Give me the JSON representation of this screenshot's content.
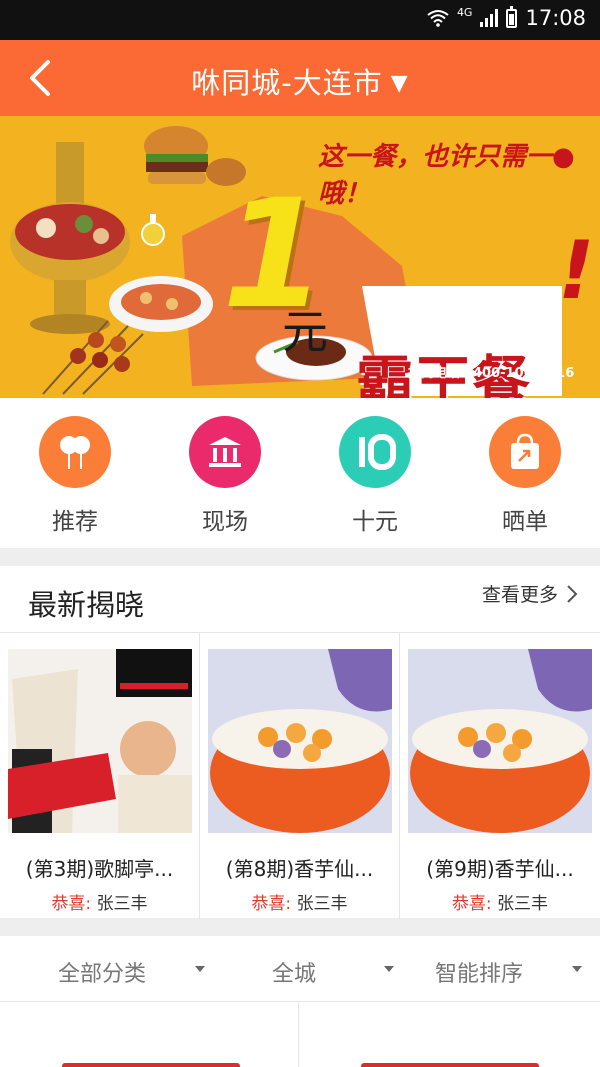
{
  "status_bar": {
    "network": "4G",
    "time": "17:08"
  },
  "header": {
    "title": "咻同城-大连市"
  },
  "banner": {
    "slogan": "这一餐，也许只需一●哦！",
    "number": "1",
    "unit": "元",
    "title": "霸王餐",
    "exclaim": "!",
    "phone": "招商电话：400-106-1016"
  },
  "categories": [
    {
      "label": "推荐",
      "icon": "balloon-icon",
      "color": "#fb7e38"
    },
    {
      "label": "现场",
      "icon": "bank-icon",
      "color": "#ea2a6a"
    },
    {
      "label": "十元",
      "icon": "ten-icon",
      "color": "#2ccdb6"
    },
    {
      "label": "晒单",
      "icon": "share-bag-icon",
      "color": "#fb7e38"
    }
  ],
  "newest": {
    "title": "最新揭晓",
    "more": "查看更多",
    "items": [
      {
        "name": "(第3期)歌脚亭...",
        "winner_label": "恭喜:",
        "winner": "张三丰",
        "image": "share-tea-drink"
      },
      {
        "name": "(第8期)香芋仙...",
        "winner_label": "恭喜:",
        "winner": "张三丰",
        "image": "taro-dessert"
      },
      {
        "name": "(第9期)香芋仙...",
        "winner_label": "恭喜:",
        "winner": "张三丰",
        "image": "taro-dessert"
      }
    ]
  },
  "filters": [
    {
      "label": "全部分类"
    },
    {
      "label": "全城"
    },
    {
      "label": "智能排序"
    }
  ]
}
